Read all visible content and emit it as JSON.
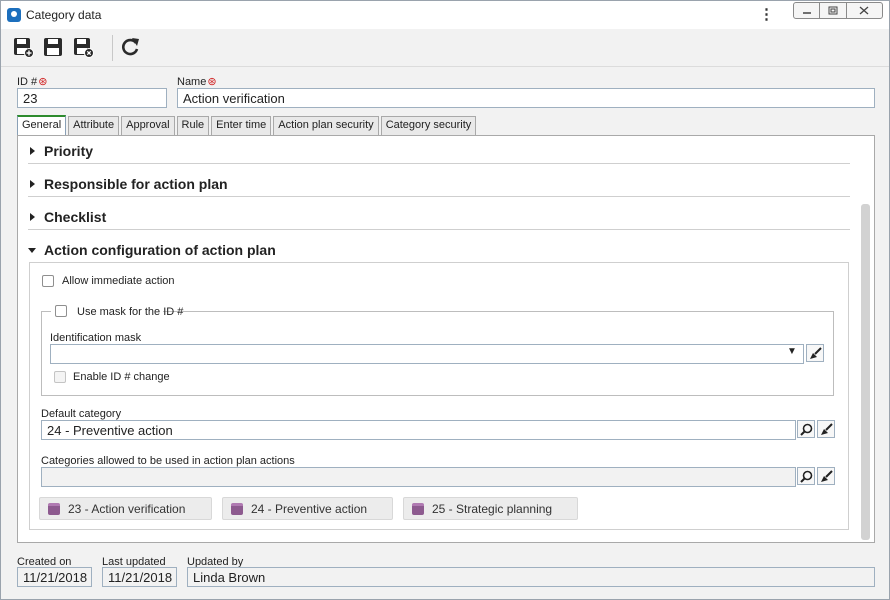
{
  "window": {
    "title": "Category data"
  },
  "toolbar": {
    "buttons": [
      {
        "name": "save-new-icon"
      },
      {
        "name": "save-icon"
      },
      {
        "name": "save-close-icon"
      },
      {
        "name": "refresh-icon"
      }
    ]
  },
  "header": {
    "id_label": "ID #",
    "id_value": "23",
    "name_label": "Name",
    "name_value": "Action verification",
    "required_mark": "⊛"
  },
  "tabs": [
    {
      "label": "General",
      "active": true
    },
    {
      "label": "Attribute"
    },
    {
      "label": "Approval"
    },
    {
      "label": "Rule"
    },
    {
      "label": "Enter time"
    },
    {
      "label": "Action plan security"
    },
    {
      "label": "Category security"
    }
  ],
  "sections": {
    "priority": "Priority",
    "responsible": "Responsible for action plan",
    "checklist": "Checklist",
    "action_config": "Action configuration of action plan"
  },
  "action_config": {
    "allow_immediate_label": "Allow immediate action",
    "use_mask_label": "Use mask for the ID #",
    "identification_mask_label": "Identification mask",
    "identification_mask_value": "",
    "enable_id_change_label": "Enable ID # change",
    "default_category_label": "Default category",
    "default_category_value": "24 - Preventive action",
    "allowed_categories_label": "Categories allowed to be used in action plan actions",
    "allowed_categories_value": "",
    "allowed_tags": [
      "23 - Action verification",
      "24 - Preventive action",
      "25 - Strategic planning"
    ]
  },
  "footer": {
    "created_on_label": "Created on",
    "created_on_value": "11/21/2018",
    "last_updated_label": "Last updated",
    "last_updated_value": "11/21/2018",
    "updated_by_label": "Updated by",
    "updated_by_value": "Linda Brown"
  }
}
